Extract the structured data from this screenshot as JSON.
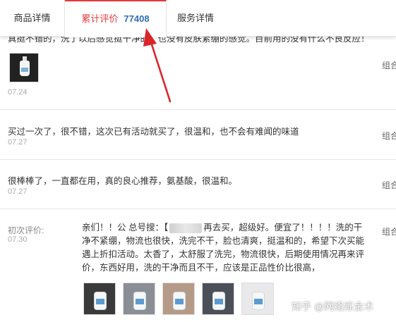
{
  "tabs": [
    {
      "label": "商品详情"
    },
    {
      "label": "累计评价",
      "count": "77408",
      "active": true
    },
    {
      "label": "服务详情"
    }
  ],
  "reviews": [
    {
      "text": "真挺不错的，洗了以后感觉挺干净的，也没有皮肤紧绷的感觉。目前用的没有什么不良反应！",
      "date": "07.24",
      "side": "组合",
      "has_image": true
    },
    {
      "text": "买过一次了，很不错，这次已有活动就买了，很温和，也不会有难闻的味道",
      "date": "07.27",
      "side": "组合"
    },
    {
      "text": "很棒棒了，一直都在用，真的良心推荐，氨基酸，很温和。",
      "date": "07.27",
      "side": "组合"
    }
  ],
  "first_review": {
    "label": "初次评价:",
    "date": "07.30",
    "text_before": "亲们！！公 总号搜：【",
    "text_after": "再去买，超级好。便宜了！！！！洗的干净不紧绷，物流也很快，洗完不干，脸也清爽，挺温和的，希望下次买能遇上折扣活动。太香了，太舒服了洗完，物流很快，后期使用情况再来评价，东西好用，洗的干净而且不干，应该是正品性价比很高，",
    "side": "组合",
    "photo_count": 5
  },
  "watermark": "知乎 @网络炼金术",
  "colors": {
    "accent": "#e4393c",
    "count": "#2f6db5",
    "arrow": "#d9262b"
  }
}
